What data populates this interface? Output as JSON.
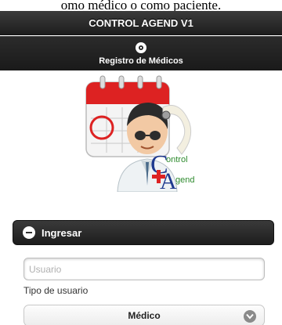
{
  "document": {
    "caption_fragment": "omo médico o como paciente."
  },
  "header": {
    "title": "CONTROL AGEND V1"
  },
  "navbar": {
    "button_label": "Registro de Médicos",
    "button_icon": "gear-icon"
  },
  "logo": {
    "text_top": "ontrol",
    "text_bottom": "gend",
    "letter_c": "C",
    "letter_a": "A"
  },
  "login": {
    "collapsible_label": "Ingresar",
    "user_placeholder": "Usuario",
    "user_value": "",
    "tipo_label": "Tipo de usuario",
    "tipo_selected": "Médico"
  },
  "colors": {
    "header_bg": "#2a2a2a",
    "accent_green": "#2e8b2e",
    "accent_blue": "#1f3a8f",
    "calendar_red": "#d22"
  }
}
